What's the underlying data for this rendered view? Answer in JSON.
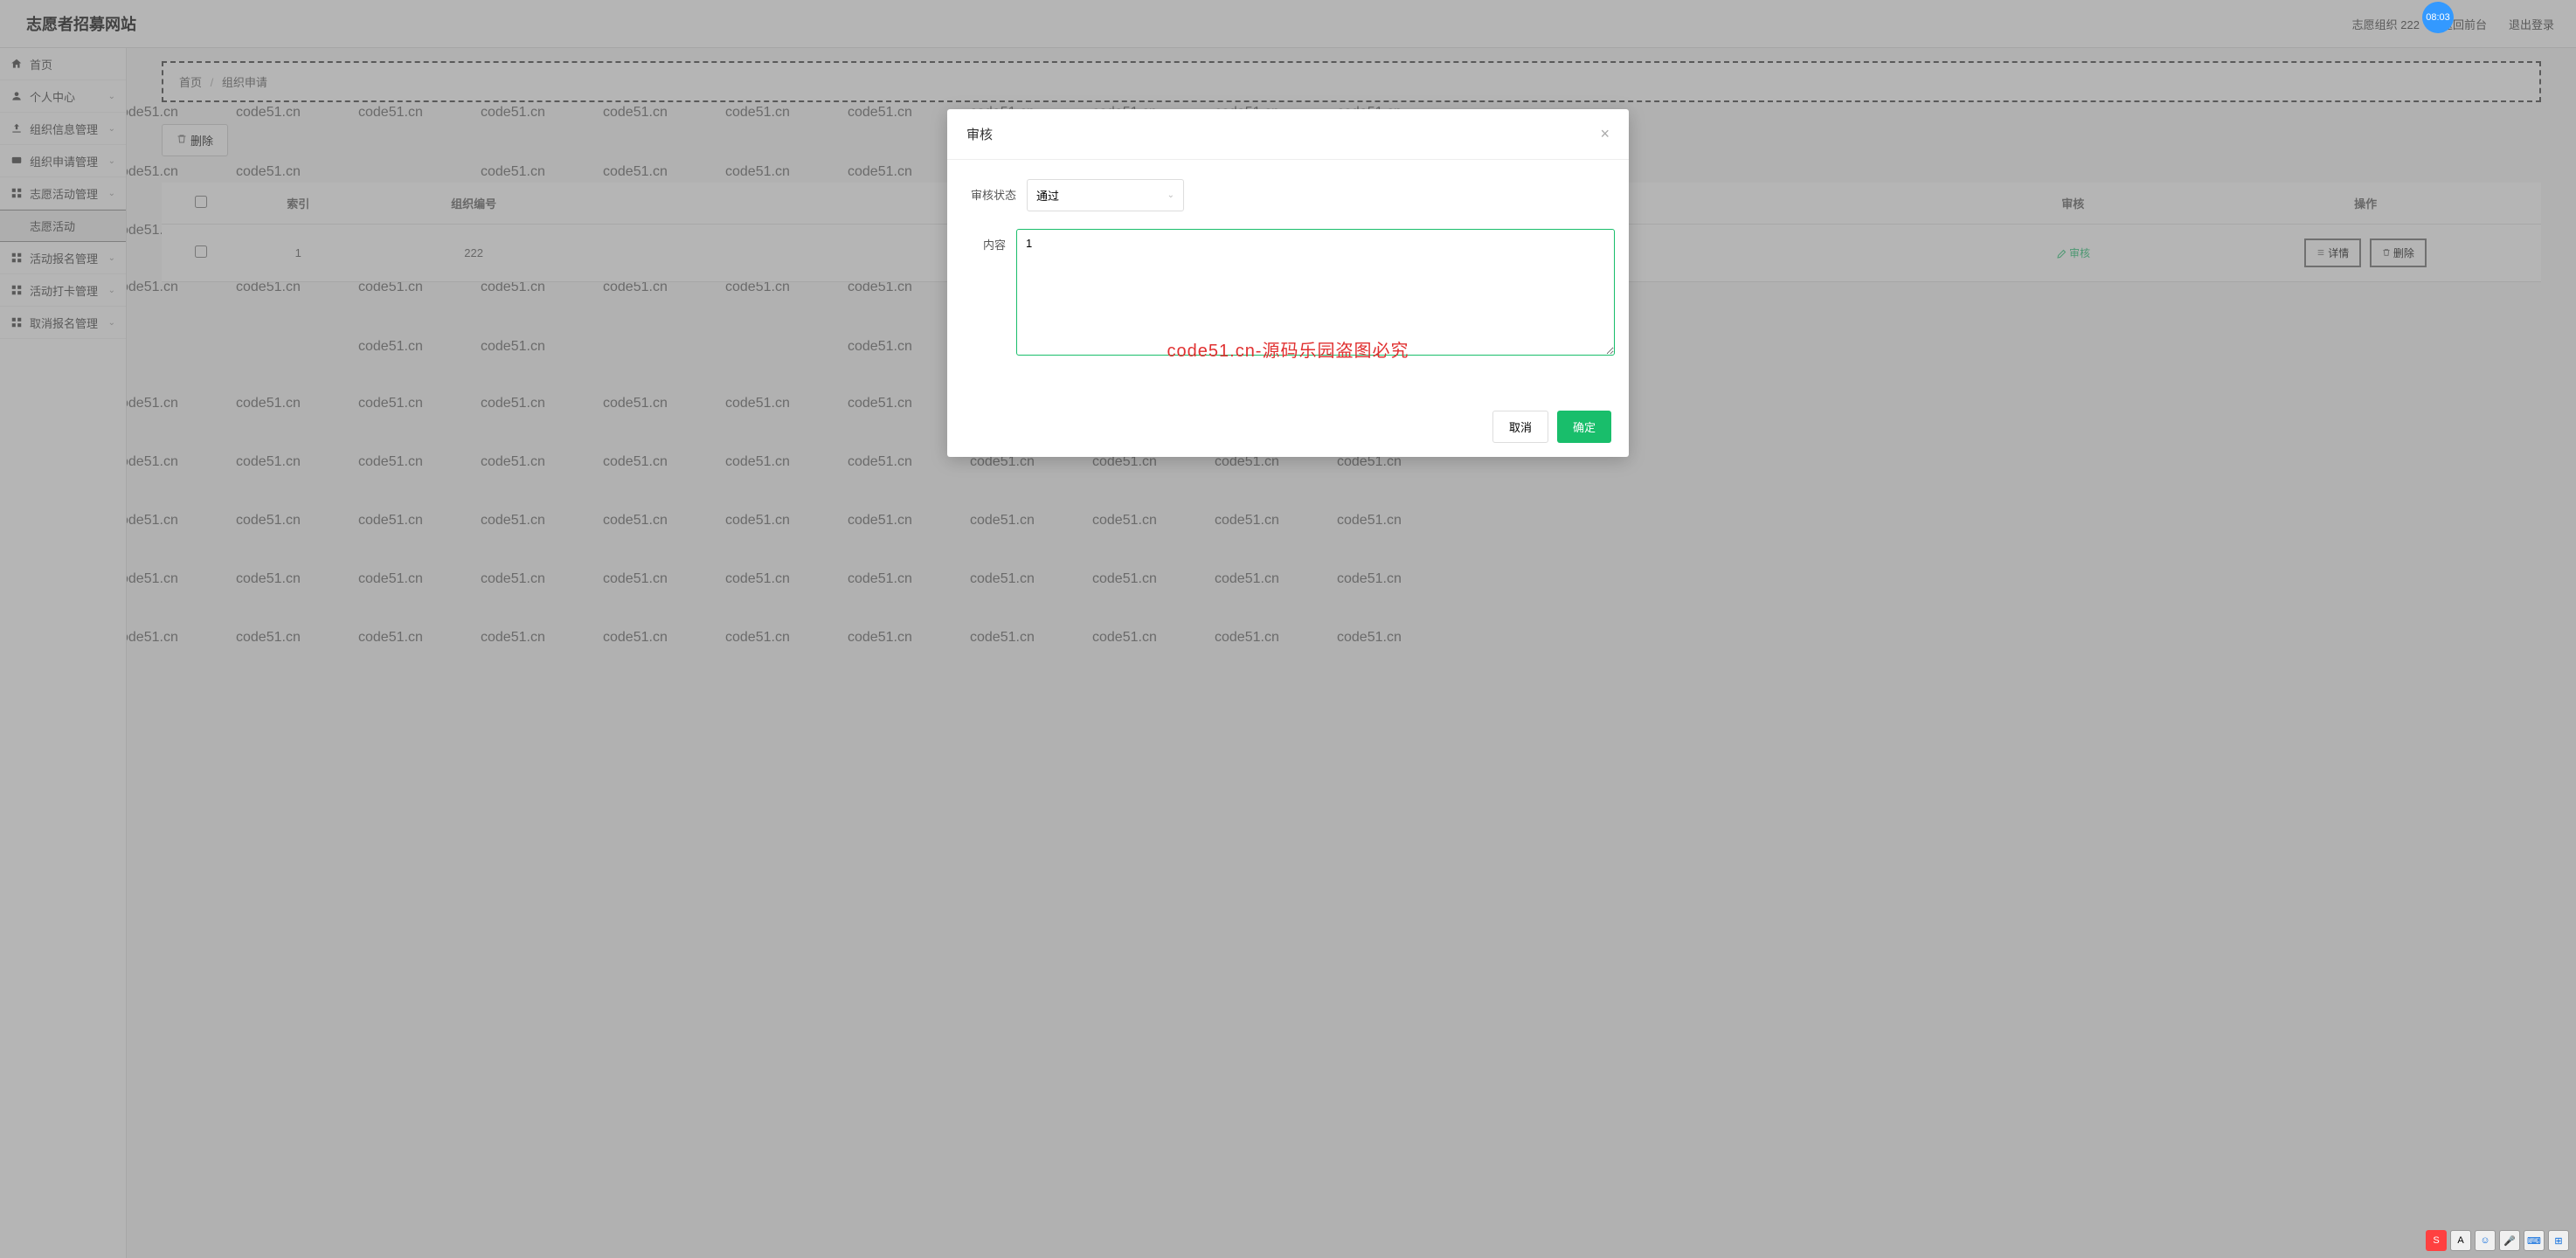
{
  "header": {
    "site_title": "志愿者招募网站",
    "org_label": "志愿组织 222",
    "back_front": "返回前台",
    "logout": "退出登录",
    "time_badge": "08:03"
  },
  "sidebar": {
    "items": [
      {
        "label": "首页",
        "icon": "home",
        "expandable": false
      },
      {
        "label": "个人中心",
        "icon": "user",
        "expandable": true
      },
      {
        "label": "组织信息管理",
        "icon": "upload",
        "expandable": true
      },
      {
        "label": "组织申请管理",
        "icon": "chat",
        "expandable": true
      },
      {
        "label": "志愿活动管理",
        "icon": "grid",
        "expandable": true
      },
      {
        "label": "志愿活动",
        "icon": "",
        "expandable": false,
        "active": true
      },
      {
        "label": "活动报名管理",
        "icon": "grid",
        "expandable": true
      },
      {
        "label": "活动打卡管理",
        "icon": "grid",
        "expandable": true
      },
      {
        "label": "取消报名管理",
        "icon": "grid",
        "expandable": true
      }
    ]
  },
  "breadcrumb": {
    "home": "首页",
    "current": "组织申请"
  },
  "toolbar": {
    "delete_label": "删除"
  },
  "table": {
    "headers": {
      "index": "索引",
      "org_no": "组织编号",
      "review": "审核",
      "actions": "操作"
    },
    "rows": [
      {
        "index": "1",
        "org_no": "222",
        "review_label": "审核",
        "detail_label": "详情",
        "delete_label": "删除"
      }
    ]
  },
  "modal": {
    "title": "审核",
    "status_label": "审核状态",
    "status_value": "通过",
    "content_label": "内容",
    "content_value": "1",
    "cancel": "取消",
    "confirm": "确定"
  },
  "watermark": {
    "gray": "code51.cn",
    "red": "code51.cn-源码乐园盗图必究"
  },
  "ime": {
    "s": "S",
    "a": "A",
    "blank": "·"
  }
}
